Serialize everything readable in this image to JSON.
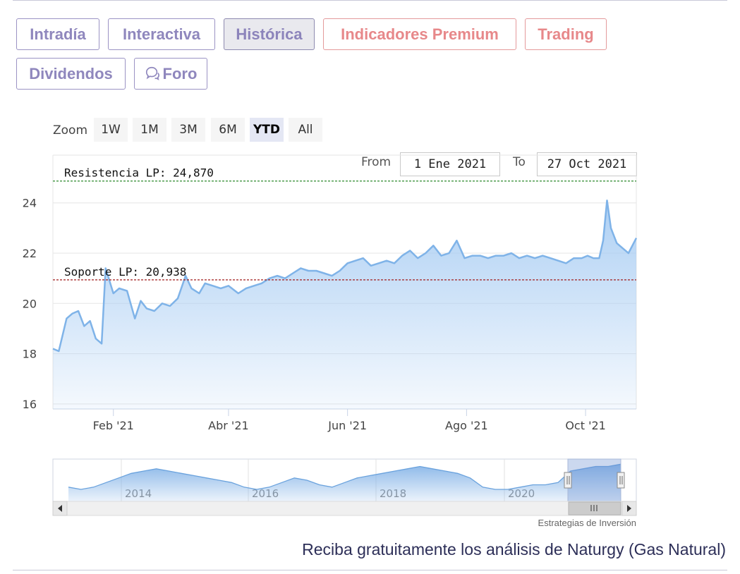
{
  "tabs": [
    {
      "label": "Intradía",
      "style": "purple",
      "active": false
    },
    {
      "label": "Interactiva",
      "style": "purple",
      "active": false
    },
    {
      "label": "Histórica",
      "style": "purple",
      "active": true
    },
    {
      "label": "Indicadores Premium",
      "style": "red",
      "active": false
    },
    {
      "label": "Trading",
      "style": "red",
      "active": false
    },
    {
      "label": "Dividendos",
      "style": "purple",
      "active": false
    },
    {
      "label": "Foro",
      "style": "purple",
      "active": false,
      "icon": "chat-bubbles-icon"
    }
  ],
  "zoom": {
    "label": "Zoom",
    "buttons": [
      "1W",
      "1M",
      "3M",
      "6M",
      "YTD",
      "All"
    ],
    "selected": "YTD"
  },
  "range": {
    "from_label": "From",
    "from_value": "1 Ene 2021",
    "to_label": "To",
    "to_value": "27 Oct 2021"
  },
  "colors": {
    "series_line": "#7fb3e8",
    "series_fill": "#a9cdf3",
    "resistance": "#2e8b2e",
    "support": "#a11e1e",
    "tab_purple": "#8f87bd",
    "tab_red": "#e7888a",
    "cta_text": "#2d2f58"
  },
  "chart_data": {
    "type": "area",
    "ylim": [
      15.8,
      25.9
    ],
    "yticks": [
      16,
      18,
      20,
      22,
      24
    ],
    "xticks": [
      "Feb '21",
      "Abr '21",
      "Jun '21",
      "Ago '21",
      "Oct '21"
    ],
    "xtick_dates": [
      "2021-02-01",
      "2021-04-01",
      "2021-06-01",
      "2021-08-01",
      "2021-10-01"
    ],
    "xlim": [
      "2021-01-01",
      "2021-10-27"
    ],
    "grid": true,
    "series": [
      {
        "x": [
          "2021-01-01",
          "2021-01-04",
          "2021-01-08",
          "2021-01-11",
          "2021-01-14",
          "2021-01-17",
          "2021-01-20",
          "2021-01-23",
          "2021-01-26",
          "2021-01-28",
          "2021-02-01",
          "2021-02-04",
          "2021-02-08",
          "2021-02-12",
          "2021-02-15",
          "2021-02-18",
          "2021-02-22",
          "2021-02-26",
          "2021-03-02",
          "2021-03-06",
          "2021-03-10",
          "2021-03-13",
          "2021-03-17",
          "2021-03-20",
          "2021-03-24",
          "2021-03-28",
          "2021-04-01",
          "2021-04-06",
          "2021-04-10",
          "2021-04-14",
          "2021-04-18",
          "2021-04-22",
          "2021-04-26",
          "2021-04-30",
          "2021-05-04",
          "2021-05-08",
          "2021-05-12",
          "2021-05-16",
          "2021-05-20",
          "2021-05-24",
          "2021-05-28",
          "2021-06-01",
          "2021-06-05",
          "2021-06-09",
          "2021-06-13",
          "2021-06-17",
          "2021-06-21",
          "2021-06-25",
          "2021-06-29",
          "2021-07-03",
          "2021-07-07",
          "2021-07-11",
          "2021-07-15",
          "2021-07-19",
          "2021-07-23",
          "2021-07-27",
          "2021-07-31",
          "2021-08-04",
          "2021-08-08",
          "2021-08-12",
          "2021-08-16",
          "2021-08-20",
          "2021-08-24",
          "2021-08-28",
          "2021-09-01",
          "2021-09-05",
          "2021-09-09",
          "2021-09-13",
          "2021-09-17",
          "2021-09-21",
          "2021-09-25",
          "2021-09-29",
          "2021-10-02",
          "2021-10-05",
          "2021-10-08",
          "2021-10-10",
          "2021-10-12",
          "2021-10-14",
          "2021-10-17",
          "2021-10-20",
          "2021-10-23",
          "2021-10-27"
        ],
        "y": [
          18.2,
          18.1,
          19.4,
          19.6,
          19.7,
          19.1,
          19.3,
          18.6,
          18.4,
          21.4,
          20.4,
          20.6,
          20.5,
          19.4,
          20.1,
          19.8,
          19.7,
          20.0,
          19.9,
          20.2,
          21.1,
          20.6,
          20.4,
          20.8,
          20.7,
          20.6,
          20.7,
          20.4,
          20.6,
          20.7,
          20.8,
          21.0,
          21.1,
          21.0,
          21.2,
          21.4,
          21.3,
          21.3,
          21.2,
          21.1,
          21.3,
          21.6,
          21.7,
          21.8,
          21.5,
          21.6,
          21.7,
          21.6,
          21.9,
          22.1,
          21.8,
          22.0,
          22.3,
          21.9,
          22.0,
          22.5,
          21.8,
          21.9,
          21.9,
          21.8,
          21.9,
          21.9,
          22.0,
          21.8,
          21.9,
          21.8,
          21.9,
          21.8,
          21.7,
          21.6,
          21.8,
          21.8,
          21.9,
          21.8,
          21.8,
          22.5,
          24.1,
          23.0,
          22.4,
          22.2,
          22.0,
          22.6
        ]
      }
    ],
    "annotations": [
      {
        "label": "Resistencia LP: 24,870",
        "y": 24.87,
        "style": "dashed-green"
      },
      {
        "label": "Soporte LP: 20,938",
        "y": 20.938,
        "style": "dashed-red"
      }
    ],
    "navigator": {
      "xticks": [
        "2014",
        "2016",
        "2018",
        "2020"
      ],
      "profile": [
        13,
        12,
        13,
        15,
        17,
        19,
        20,
        21,
        20,
        19,
        18,
        17,
        16,
        15,
        13,
        12,
        13,
        15,
        17,
        16,
        14,
        13,
        15,
        17,
        18,
        19,
        20,
        21,
        22,
        21,
        20,
        19,
        17,
        13,
        12,
        12,
        13,
        14,
        14,
        15,
        20,
        21,
        22,
        22,
        23
      ]
    }
  },
  "footer": {
    "credit": "Estrategias de Inversión",
    "cta": "Reciba gratuitamente los análisis de Naturgy (Gas Natural)"
  }
}
